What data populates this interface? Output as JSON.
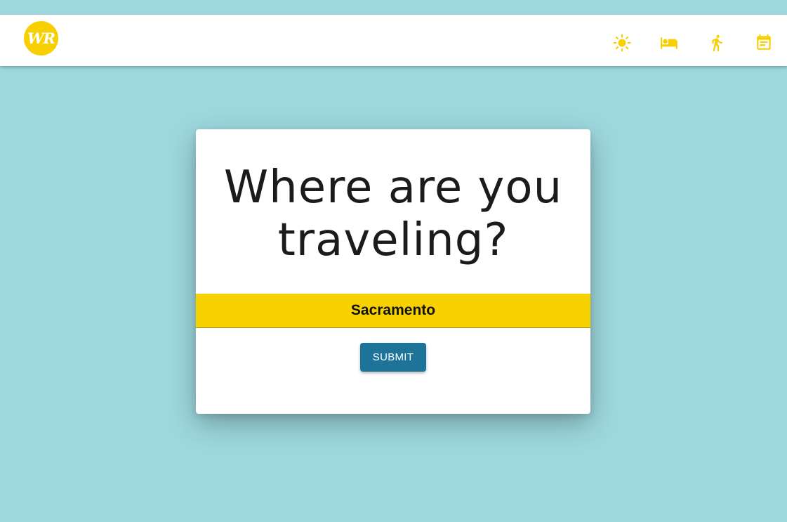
{
  "header": {
    "logo_text": "WR",
    "nav": [
      {
        "icon": "sun-icon",
        "label": ""
      },
      {
        "icon": "bed-icon",
        "label": ""
      },
      {
        "icon": "walking-person-icon",
        "label": ""
      },
      {
        "icon": "calendar-event-icon",
        "label": ""
      }
    ]
  },
  "card": {
    "heading": "Where are you traveling?",
    "city_input_value": "Sacramento",
    "submit_label": "SUBMIT"
  },
  "colors": {
    "background": "#9dd8de",
    "accent_yellow": "#f7d100",
    "button_blue": "#1e7399"
  }
}
